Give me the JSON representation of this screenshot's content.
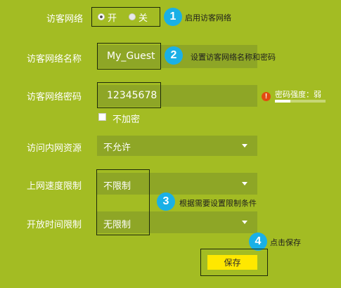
{
  "guest_network": {
    "label": "访客网络",
    "option_on": "开",
    "option_off": "关",
    "selected": "开"
  },
  "ssid": {
    "label": "访客网络名称",
    "value": "My_Guest"
  },
  "password": {
    "label": "访客网络密码",
    "value": "12345678",
    "strength_label": "密码强度：弱",
    "strength_level": 0.3,
    "no_encrypt_label": "不加密",
    "no_encrypt_checked": false
  },
  "lan_access": {
    "label": "访问内网资源",
    "value": "不允许"
  },
  "speed_limit": {
    "label": "上网速度限制",
    "value": "不限制"
  },
  "time_limit": {
    "label": "开放时间限制",
    "value": "无限制"
  },
  "save_button": {
    "label": "保存"
  },
  "steps": [
    {
      "number": "1",
      "text": "启用访客网络"
    },
    {
      "number": "2",
      "text": "设置访客网络名称和密码"
    },
    {
      "number": "3",
      "text": "根据需要设置限制条件"
    },
    {
      "number": "4",
      "text": "点击保存"
    }
  ],
  "colors": {
    "background": "#a3bc23",
    "field": "#8ea626",
    "step_badge": "#1ab0e6",
    "save_button": "#ffe800",
    "warning": "#e34b10"
  },
  "icons": {
    "warning": "exclamation-circle-icon",
    "dropdown": "caret-down-icon"
  }
}
